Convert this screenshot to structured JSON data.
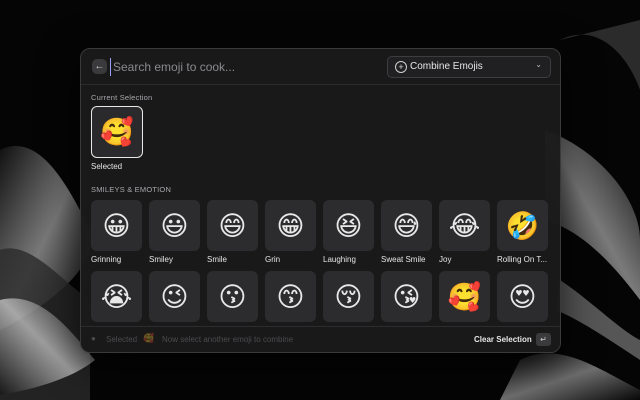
{
  "topbar": {
    "back_icon": "arrow-left-icon",
    "search_placeholder": "Search emoji to cook...",
    "combine_icon": "plus-circle-icon",
    "combine_label": "Combine Emojis",
    "combine_chevron_icon": "chevron-down-icon"
  },
  "current": {
    "title": "Current Selection",
    "emoji": "🥰",
    "label": "Selected"
  },
  "section": {
    "title": "SMILEYS & EMOTION"
  },
  "grid": {
    "row1": [
      {
        "emoji": "😀",
        "label": "Grinning"
      },
      {
        "emoji": "😃",
        "label": "Smiley"
      },
      {
        "emoji": "😄",
        "label": "Smile"
      },
      {
        "emoji": "😁",
        "label": "Grin"
      },
      {
        "emoji": "😆",
        "label": "Laughing"
      },
      {
        "emoji": "😅",
        "label": "Sweat Smile"
      },
      {
        "emoji": "😂",
        "label": "Joy"
      },
      {
        "emoji": "🤣",
        "label": "Rolling On T..."
      }
    ],
    "row2": [
      {
        "emoji": "😭"
      },
      {
        "emoji": "😉"
      },
      {
        "emoji": "😗"
      },
      {
        "emoji": "😙"
      },
      {
        "emoji": "😚"
      },
      {
        "emoji": "😘"
      },
      {
        "emoji": "🥰"
      },
      {
        "emoji": "😍"
      }
    ]
  },
  "footer": {
    "status": "Selected",
    "emoji": "🥰",
    "hint": "Now select another emoji to combine",
    "clear_label": "Clear Selection",
    "enter_icon": "return-key-icon",
    "enter_glyph": "↵"
  },
  "colors": {
    "window_bg": "#1a1a1b",
    "tile_bg": "#2c2c2e",
    "accent_caret": "#9aa0ff"
  }
}
